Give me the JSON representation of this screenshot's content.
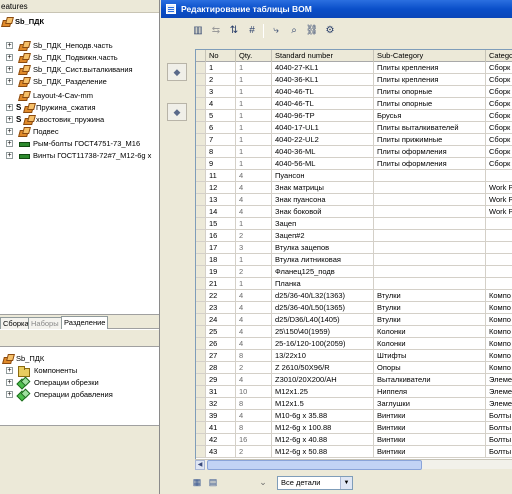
{
  "feature_panel": {
    "title": "eatures",
    "tree": [
      {
        "label": "Sb_ПДК",
        "icon": "assembly-icon",
        "bold": true
      },
      {
        "label": "Sb_ПДК_Неподв.часть",
        "icon": "assembly-icon",
        "expander": "+"
      },
      {
        "label": "Sb_ПДК_Подвижн.часть",
        "icon": "assembly-icon",
        "expander": "+"
      },
      {
        "label": "Sb_ПДК_Сист.выталкивания",
        "icon": "assembly-icon",
        "expander": "+"
      },
      {
        "label": "Sb_ПДК_Разделение",
        "icon": "assembly-icon",
        "expander": "+"
      },
      {
        "label": "Layout-4-Cav-mm",
        "icon": "layout-icon"
      },
      {
        "label": "Пружина_сжатия",
        "icon": "part-icon",
        "expander": "+",
        "prefix": "S"
      },
      {
        "label": "хвостовик_пружина",
        "icon": "part-icon",
        "expander": "+",
        "prefix": "S"
      },
      {
        "label": "Подвес",
        "icon": "part-icon",
        "expander": "+"
      },
      {
        "label": "Рым-болты ГОСТ4751-73_М16",
        "icon": "bolt-icon",
        "expander": "+"
      },
      {
        "label": "Винты ГОСТ11738-72#7_M12-6g x",
        "icon": "bolt-icon",
        "expander": "+"
      }
    ],
    "tabs": [
      "Сборка",
      "Наборы",
      "Разделение"
    ],
    "tree2": [
      {
        "label": "Sb_ПДК",
        "icon": "assembly-icon"
      },
      {
        "label": "Компоненты",
        "icon": "components-icon",
        "expander": "+"
      },
      {
        "label": "Операции обрезки",
        "icon": "cut-icon",
        "expander": "+"
      },
      {
        "label": "Операции добавления",
        "icon": "add-icon",
        "expander": "+"
      }
    ]
  },
  "bom_window": {
    "title": "Редактирование таблицы BOM",
    "toolbar_icons": [
      "table-properties-icon",
      "merge-icon",
      "sort-icon",
      "renumber-icon",
      "export-icon",
      "search-replace-icon",
      "link-icon",
      "settings-icon"
    ],
    "side_buttons": [
      "move-up-icon",
      "move-down-icon"
    ],
    "columns": [
      "No",
      "Qty.",
      "Standard number",
      "Sub-Category",
      "Catego"
    ],
    "rows": [
      [
        "1",
        "1",
        "4040-27-KL1",
        "Плиты крепления",
        "Сборк"
      ],
      [
        "2",
        "1",
        "4040-36-KL1",
        "Плиты крепления",
        "Сборк"
      ],
      [
        "3",
        "1",
        "4040-46-TL",
        "Плиты опорные",
        "Сборк"
      ],
      [
        "4",
        "1",
        "4040-46-TL",
        "Плиты опорные",
        "Сборк"
      ],
      [
        "5",
        "1",
        "4040-96-TP",
        "Брусья",
        "Сборк"
      ],
      [
        "6",
        "1",
        "4040-17-UL1",
        "Плиты выталкивателей",
        "Сборк"
      ],
      [
        "7",
        "1",
        "4040-22-UL2",
        "Плиты прижимные",
        "Сборк"
      ],
      [
        "8",
        "1",
        "4040-36-ML",
        "Плиты оформления",
        "Сборк"
      ],
      [
        "9",
        "1",
        "4040-56-ML",
        "Плиты оформления",
        "Сборк"
      ],
      [
        "11",
        "4",
        "Пуансон",
        "",
        ""
      ],
      [
        "12",
        "4",
        "Знак матрицы",
        "",
        "Work P"
      ],
      [
        "13",
        "4",
        "Знак пуансона",
        "",
        "Work P"
      ],
      [
        "14",
        "4",
        "Знак боковой",
        "",
        "Work P"
      ],
      [
        "15",
        "1",
        "Зацеп",
        "",
        ""
      ],
      [
        "16",
        "2",
        "Зацеп#2",
        "",
        ""
      ],
      [
        "17",
        "3",
        "Втулка зацепов",
        "",
        ""
      ],
      [
        "18",
        "1",
        "Втулка литниковая",
        "",
        ""
      ],
      [
        "19",
        "2",
        "Фланец125_подв",
        "",
        ""
      ],
      [
        "21",
        "1",
        "Планка",
        "",
        ""
      ],
      [
        "22",
        "4",
        "d25/36-40/L32(1363)",
        "Втулки",
        "Компо"
      ],
      [
        "23",
        "4",
        "d25/36-40/L50(1365)",
        "Втулки",
        "Компо"
      ],
      [
        "24",
        "4",
        "d25/D36/L40(1405)",
        "Втулки",
        "Компо"
      ],
      [
        "25",
        "4",
        "25\\150\\40(1959)",
        "Колонки",
        "Компо"
      ],
      [
        "26",
        "4",
        "25-16/120-100(2059)",
        "Колонки",
        "Компо"
      ],
      [
        "27",
        "8",
        "13/22x10",
        "Штифты",
        "Компо"
      ],
      [
        "28",
        "2",
        "Z 2610/50X96/R",
        "Опоры",
        "Компо"
      ],
      [
        "29",
        "4",
        "Z3010/20X200/AH",
        "Выталкиватели",
        "Элеме"
      ],
      [
        "31",
        "10",
        "M12x1.25",
        "Ниппеля",
        "Элеме"
      ],
      [
        "32",
        "8",
        "M12x1.5",
        "Заглушки",
        "Элеме"
      ],
      [
        "39",
        "4",
        "M10-6g x 35.88",
        "Винтики",
        "Болты"
      ],
      [
        "41",
        "8",
        "M12-6g x 100.88",
        "Винтики",
        "Болты"
      ],
      [
        "42",
        "16",
        "M12-6g x 40.88",
        "Винтики",
        "Болты"
      ],
      [
        "43",
        "2",
        "M12-6g x 50.88",
        "Винтики",
        "Болты"
      ]
    ],
    "filter_value": "Все детали",
    "bottom_icons": [
      "bom-add-icon",
      "bom-table-icon"
    ]
  }
}
